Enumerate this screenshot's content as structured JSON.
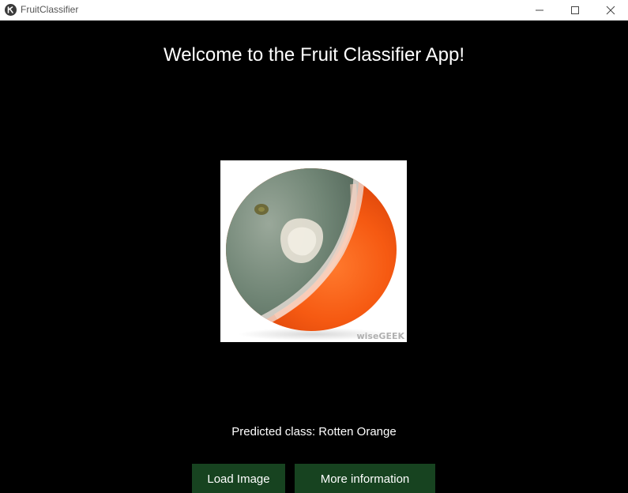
{
  "window": {
    "title": "FruitClassifier"
  },
  "main": {
    "heading": "Welcome to the Fruit Classifier App!",
    "image_watermark": "wiseGEEK",
    "prediction_text": "Predicted class: Rotten Orange"
  },
  "buttons": {
    "load_label": "Load Image",
    "more_label": "More information"
  },
  "colors": {
    "background": "#000000",
    "button_bg": "#174320",
    "text": "#ffffff"
  },
  "icons": {
    "app": "kivy-app-icon",
    "minimize": "minimize-icon",
    "maximize": "maximize-icon",
    "close": "close-icon"
  }
}
